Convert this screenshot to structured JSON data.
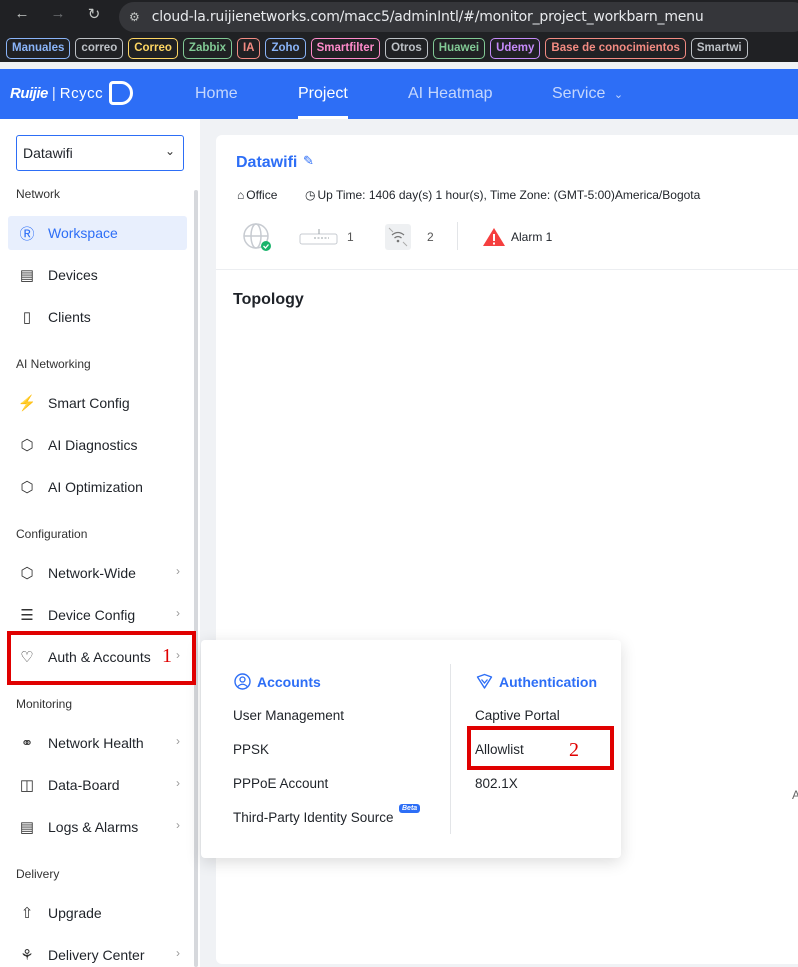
{
  "browser": {
    "url": "cloud-la.ruijienetworks.com/macc5/adminIntl/#/monitor_project_workbarn_menu",
    "back_icon": "arrow-left-icon",
    "forward_icon": "arrow-right-icon",
    "reload_icon": "reload-icon"
  },
  "bookmarks": [
    {
      "label": "Manuales",
      "color": "#8ab4f8"
    },
    {
      "label": "correo",
      "color": "#bdc1c6"
    },
    {
      "label": "Correo",
      "color": "#fdd663"
    },
    {
      "label": "Zabbix",
      "color": "#81c995"
    },
    {
      "label": "IA",
      "color": "#f28b82"
    },
    {
      "label": "Zoho",
      "color": "#8ab4f8"
    },
    {
      "label": "Smartfilter",
      "color": "#ff8bcb"
    },
    {
      "label": "Otros",
      "color": "#bdc1c6"
    },
    {
      "label": "Huawei",
      "color": "#81c995"
    },
    {
      "label": "Udemy",
      "color": "#c58af9"
    },
    {
      "label": "Base de conocimientos",
      "color": "#f28b82"
    },
    {
      "label": "Smartwi",
      "color": "#bdc1c6"
    }
  ],
  "header": {
    "logo_brand": "Ruijie",
    "logo_sep": "|",
    "logo_product": "Rcycc",
    "nav": [
      "Home",
      "Project",
      "AI Heatmap",
      "Service"
    ],
    "active": "Project",
    "accent_color": "#2d6ef6"
  },
  "sidebar": {
    "project_select": "Datawifi",
    "sections": {
      "network": "Network",
      "ai_networking": "AI Networking",
      "configuration": "Configuration",
      "monitoring": "Monitoring",
      "delivery": "Delivery"
    },
    "items": {
      "workspace": {
        "label": "Workspace",
        "icon": "workspace-icon"
      },
      "devices": {
        "label": "Devices",
        "icon": "devices-icon"
      },
      "clients": {
        "label": "Clients",
        "icon": "clients-icon"
      },
      "smart_config": {
        "label": "Smart Config",
        "icon": "smart-config-icon"
      },
      "ai_diagnostics": {
        "label": "AI Diagnostics",
        "icon": "ai-diagnostics-icon"
      },
      "ai_optimization": {
        "label": "AI Optimization",
        "icon": "ai-optimization-icon"
      },
      "network_wide": {
        "label": "Network-Wide",
        "icon": "network-wide-icon"
      },
      "device_config": {
        "label": "Device Config",
        "icon": "device-config-icon"
      },
      "auth_accounts": {
        "label": "Auth & Accounts",
        "icon": "auth-icon"
      },
      "network_health": {
        "label": "Network Health",
        "icon": "network-health-icon"
      },
      "data_board": {
        "label": "Data-Board",
        "icon": "data-board-icon"
      },
      "logs_alarms": {
        "label": "Logs & Alarms",
        "icon": "logs-icon"
      },
      "upgrade": {
        "label": "Upgrade",
        "icon": "upgrade-icon"
      },
      "delivery_center": {
        "label": "Delivery Center",
        "icon": "delivery-center-icon"
      }
    }
  },
  "annotations": {
    "one": "1",
    "two": "2",
    "color": "#e00000"
  },
  "project": {
    "name": "Datawifi",
    "scene": "Office",
    "uptime": "Up Time: 1406 day(s) 1 hour(s), Time Zone: (GMT-5:00)America/Bogota",
    "gateway_count": "1",
    "ap_count": "2",
    "alarm_label": "Alarm 1",
    "topology_title": "Topology",
    "cut_text": "A"
  },
  "dropdown": {
    "accounts": {
      "title": "Accounts",
      "items": [
        "User Management",
        "PPSK",
        "PPPoE Account",
        "Third-Party Identity Source"
      ],
      "beta": "Beta"
    },
    "authentication": {
      "title": "Authentication",
      "items": [
        "Captive Portal",
        "Allowlist",
        "802.1X"
      ]
    }
  }
}
